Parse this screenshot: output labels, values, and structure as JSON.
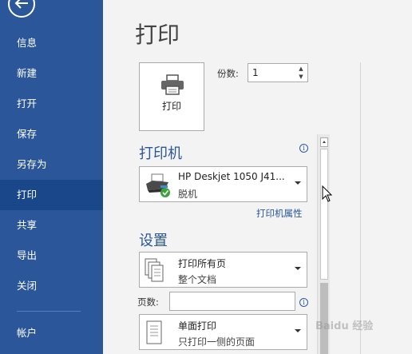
{
  "sidebar": {
    "back_label": "",
    "items": [
      {
        "label": "信息",
        "active": false
      },
      {
        "label": "新建",
        "active": false
      },
      {
        "label": "打开",
        "active": false
      },
      {
        "label": "保存",
        "active": false
      },
      {
        "label": "另存为",
        "active": false
      },
      {
        "label": "打印",
        "active": true
      },
      {
        "label": "共享",
        "active": false
      },
      {
        "label": "导出",
        "active": false
      },
      {
        "label": "关闭",
        "active": false
      }
    ],
    "account_label": "帐户",
    "bg_color": "#2b579a",
    "active_color": "#19478a"
  },
  "main": {
    "title": "打印",
    "print_button_label": "打印",
    "copies": {
      "label": "份数:",
      "value": "1"
    },
    "printer_section": {
      "heading": "打印机",
      "printer_name": "HP Deskjet 1050 J41...",
      "printer_status": "脱机",
      "properties_link": "打印机属性"
    },
    "settings_section": {
      "heading": "设置",
      "pages_dropdown": {
        "primary": "打印所有页",
        "secondary": "整个文档"
      },
      "pages_label": "页数:",
      "pages_value": "",
      "sides_dropdown": {
        "primary": "单面打印",
        "secondary": "只打印一侧的页面"
      }
    }
  },
  "watermark_text": "Baidu 经验",
  "icons": {
    "back": "arrow-left-icon",
    "printer": "printer-icon",
    "info": "info-icon",
    "caret": "chevron-down-icon"
  },
  "accent_color": "#2b579a"
}
